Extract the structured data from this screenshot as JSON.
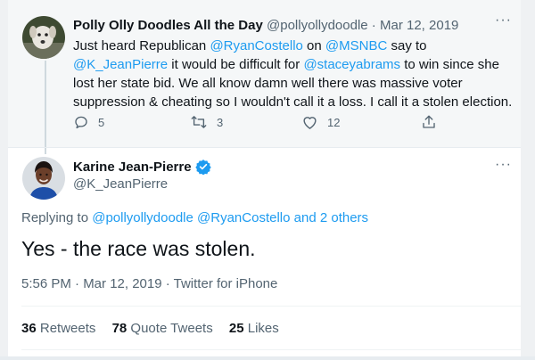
{
  "parent_tweet": {
    "display_name": "Polly Olly Doodles All the Day",
    "handle": "@pollyollydoodle",
    "separator": " · ",
    "date": "Mar 12, 2019",
    "more": "···",
    "text": {
      "t1": "Just heard Republican ",
      "m1": "@RyanCostello",
      "t2": " on ",
      "m2": "@MSNBC",
      "t3": " say to ",
      "m3": "@K_JeanPierre",
      "t4": " it would be difficult for ",
      "m4": "@staceyabrams",
      "t5": " to win since she lost her state bid. We all know damn well there was massive voter suppression & cheating so I wouldn't call it a loss. I call it a stolen election."
    },
    "actions": {
      "replies": "5",
      "retweets": "3",
      "likes": "12"
    }
  },
  "main_tweet": {
    "display_name": "Karine Jean-Pierre",
    "handle": "@K_JeanPierre",
    "more": "···",
    "replying": {
      "prefix": "Replying to ",
      "to1": "@pollyollydoodle",
      "to2": "@RyanCostello",
      "and": " and ",
      "others": "2 others"
    },
    "text": "Yes - the race was stolen.",
    "meta": "5:56 PM · Mar 12, 2019 · Twitter for iPhone",
    "stats": {
      "retweets_count": "36",
      "retweets_label": "Retweets",
      "quotes_count": "78",
      "quotes_label": "Quote Tweets",
      "likes_count": "25",
      "likes_label": "Likes"
    }
  },
  "colors": {
    "link": "#1d9bf0",
    "muted": "#536471",
    "text": "#0f1419",
    "verified": "#1d9bf0"
  }
}
